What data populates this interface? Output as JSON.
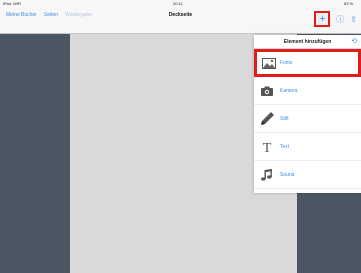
{
  "status": {
    "device": "iPad",
    "wifi": "WiFi",
    "time": "20:11",
    "battery": "83 %"
  },
  "nav": {
    "my_books": "Meine Bücher",
    "pages": "Seiten",
    "play": "Wiedergabe",
    "title": "Deckseite",
    "add_symbol": "+",
    "info_symbol": "ⓘ",
    "share_symbol": "⇪"
  },
  "popover": {
    "title": "Element hinzufügen",
    "items": [
      {
        "label": "Fotos",
        "icon": "photo-icon"
      },
      {
        "label": "Kamera",
        "icon": "camera-icon"
      },
      {
        "label": "Stift",
        "icon": "pen-icon"
      },
      {
        "label": "Text",
        "icon": "text-icon"
      },
      {
        "label": "Sound",
        "icon": "music-note-icon"
      }
    ]
  },
  "colors": {
    "accent": "#3a8ee6",
    "highlight": "#e21a1a",
    "background": "#4a5763",
    "page": "#d9d9d9"
  }
}
